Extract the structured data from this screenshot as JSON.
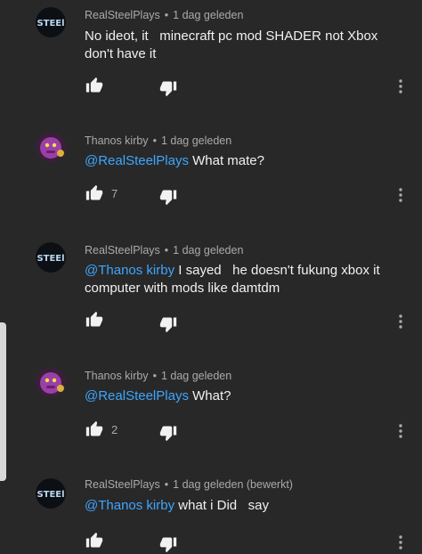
{
  "comments": [
    {
      "author": "RealSteelPlays",
      "avatar": "steel-logo-avatar",
      "time": "1 dag geleden",
      "mention": "",
      "text": "No ideot, it   minecraft pc mod SHADER not Xbox don't have it",
      "likes": ""
    },
    {
      "author": "Thanos kirby",
      "avatar": "purple-kirby-avatar",
      "time": "1 dag geleden",
      "mention": "@RealSteelPlays",
      "text": " What mate?",
      "likes": "7"
    },
    {
      "author": "RealSteelPlays",
      "avatar": "steel-logo-avatar",
      "time": "1 dag geleden",
      "mention": "@Thanos kirby",
      "text": " I sayed   he doesn't fukung xbox it computer with mods like damtdm",
      "likes": ""
    },
    {
      "author": "Thanos kirby",
      "avatar": "purple-kirby-avatar",
      "time": "1 dag geleden",
      "mention": "@RealSteelPlays",
      "text": " What?",
      "likes": "2"
    },
    {
      "author": "RealSteelPlays",
      "avatar": "steel-logo-avatar",
      "time": "1 dag geleden (bewerkt)",
      "mention": "@Thanos kirby",
      "text": " what i Did   say",
      "likes": ""
    }
  ],
  "separator": "•",
  "avatar_text": "STEEl",
  "icons": {
    "like": "thumbs-up-icon",
    "dislike": "thumbs-down-icon",
    "more": "more-vert-icon"
  },
  "colors": {
    "background": "#282828",
    "mention": "#3ea6ff",
    "meta": "#aaaaaa"
  }
}
